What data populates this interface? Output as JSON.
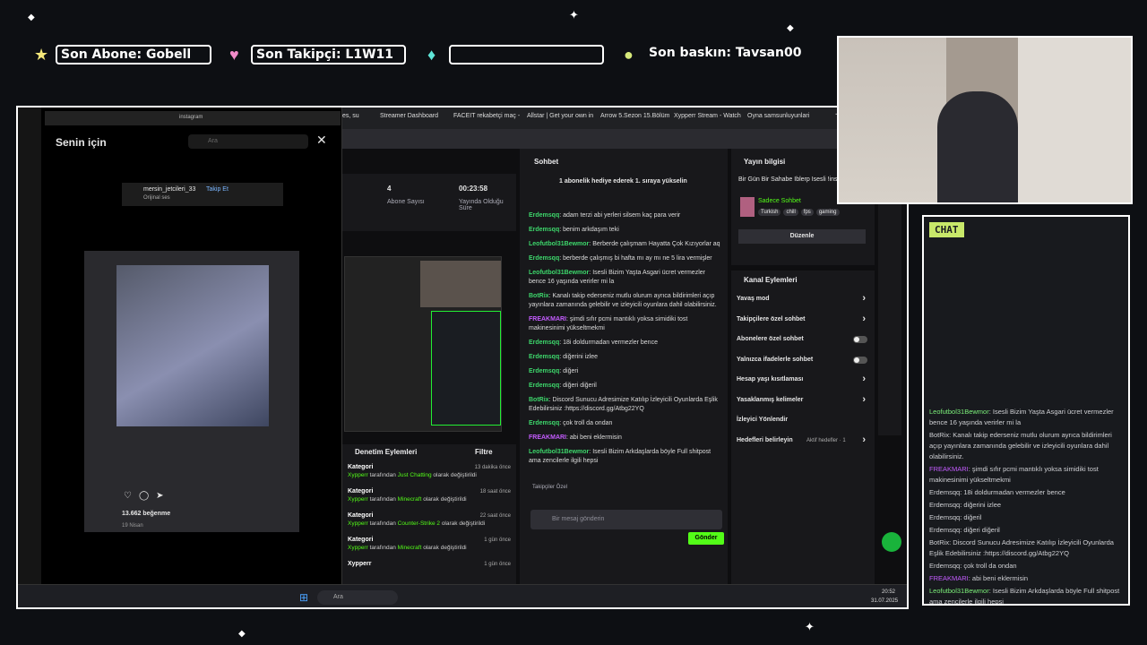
{
  "alerts": {
    "sub": "Son Abone: Gobell",
    "follow": "Son Takipçi: L1W11",
    "bits": "",
    "raid": "Son baskın: Tavsan00"
  },
  "browser_tabs": [
    "es, su",
    "Streamer Dashboard",
    "FACEIT rekabetçi maç -",
    "Allstar | Get your own in",
    "Arrow 5.Sezon 15.Bölüm",
    "Xypperr Stream - Watch",
    "Oyna samsunluyunlari"
  ],
  "instagram": {
    "url": "instagram",
    "header": "Senin için",
    "search": "Ara",
    "account": "mersin_jetcileri_33",
    "follow": "Takip Et",
    "audio": "Orijinal ses",
    "likes": "13.662 beğenme",
    "date": "19 Nisan"
  },
  "stats": {
    "subs": "4",
    "subs_label": "Abone Sayısı",
    "uptime": "00:23:58",
    "uptime_label": "Yayında Olduğu Süre"
  },
  "chat_panel": {
    "title": "Sohbet",
    "hype": "1 abonelik hediye ederek 1. sıraya yükselin",
    "placeholder": "Bir mesaj gönderin",
    "send": "Gönder",
    "follower_mode": "Takipçiler Özel",
    "messages": [
      {
        "user": "Erdemsqq",
        "text": "adam terzi abi yerleri silsem kaç para verir",
        "color": "#3dd66b"
      },
      {
        "user": "Erdemsqq",
        "text": "benim arkdaşım teki",
        "color": "#3dd66b"
      },
      {
        "user": "Leofutbol31Bewmor",
        "text": "Berberde çalışmam Hayatta Çok Kızıyorlar aq",
        "color": "#3dd66b"
      },
      {
        "user": "Erdemsqq",
        "text": "berberde çalışmış bi hafta mı ay mı ne 5 lira vermişler",
        "color": "#3dd66b"
      },
      {
        "user": "Leofutbol31Bewmor",
        "text": "Isesli Bizim Yaşta Asgari ücret vermezler bence 16 yaşında verirler mi la",
        "color": "#3dd66b"
      },
      {
        "user": "BotRix",
        "text": "Kanalı takip ederseniz mutlu olurum ayrıca bildirimleri açıp yayınlara zamanında gelebilir ve izleyicili oyunlara dahil olabilirsiniz.",
        "color": "#3dd66b"
      },
      {
        "user": "FREAKMARI",
        "text": "şimdi sıfır pcmi mantıklı yoksa simidiki tost makinesinimi yükseltmekmi",
        "color": "#c45cff"
      },
      {
        "user": "Erdemsqq",
        "text": "18i doldurmadan vermezler bence",
        "color": "#3dd66b"
      },
      {
        "user": "Erdemsqq",
        "text": "diğerini izlee",
        "color": "#3dd66b"
      },
      {
        "user": "Erdemsqq",
        "text": "diğeri",
        "color": "#3dd66b"
      },
      {
        "user": "Erdemsqq",
        "text": "diğeri diğeril",
        "color": "#3dd66b"
      },
      {
        "user": "BotRix",
        "text": "Discord Sunucu Adresimize Katılıp İzleyicili Oyunlarda Eşlik Edebilirsiniz :https://discord.gg/Atbg22YQ",
        "color": "#3dd66b"
      },
      {
        "user": "Erdemsqq",
        "text": "çok troll da ondan",
        "color": "#3dd66b"
      },
      {
        "user": "FREAKMARI",
        "text": "abi beni eklermisin",
        "color": "#c45cff"
      },
      {
        "user": "Leofutbol31Bewmor",
        "text": "Isesli Bizim Arkdaşlarda böyle Full shitpost ama zencilerle ilgili hepsi",
        "color": "#3dd66b"
      }
    ]
  },
  "stream_info": {
    "title": "Yayın bilgisi",
    "stream_title": "Bir Gün Bir Sahabe Iblerp Isesli !insta !dc",
    "category": "Sadece Sohbet",
    "tags": [
      "Turkish",
      "chill",
      "fps",
      "gaming"
    ],
    "edit": "Düzenle"
  },
  "channel_actions": {
    "title": "Kanal Eylemleri",
    "items": [
      "Yavaş mod",
      "Takipçilere özel sohbet",
      "Abonelere özel sohbet",
      "Yalnızca ifadelerle sohbet",
      "Hesap yaşı kısıtlaması",
      "Yasaklanmış kelimeler",
      "İzleyici Yönlendir",
      "Hedefleri belirleyin"
    ],
    "goal": "Aktif hedefler · 1"
  },
  "mod_actions": {
    "title": "Denetim Eylemleri",
    "filter": "Filtre",
    "items": [
      {
        "kind": "Kategori",
        "by": "Xypperr",
        "pre": "tarafından",
        "cat": "Just Chatting",
        "post": "olarak değiştirildi",
        "time": "13 dakika önce"
      },
      {
        "kind": "Kategori",
        "by": "Xypperr",
        "pre": "tarafından",
        "cat": "Minecraft",
        "post": "olarak değiştirildi",
        "time": "18 saat önce"
      },
      {
        "kind": "Kategori",
        "by": "Xypperr",
        "pre": "tarafından",
        "cat": "Counter-Strike 2",
        "post": "olarak değiştirildi",
        "time": "22 saat önce"
      },
      {
        "kind": "Kategori",
        "by": "Xypperr",
        "pre": "tarafından",
        "cat": "Minecraft",
        "post": "olarak değiştirildi",
        "time": "1 gün önce"
      },
      {
        "kind": "Xypperr",
        "by": "",
        "pre": "",
        "cat": "",
        "post": "",
        "time": "1 gün önce"
      }
    ]
  },
  "taskbar": {
    "search": "Ara",
    "time": "20:52",
    "date": "31.07.2025"
  },
  "overlay_chat": {
    "title": "CHAT",
    "lines": [
      {
        "user": "Leofutbol31Bewmor",
        "text": ": Isesli Bizim Yaşta Asgari ücret vermezler bence 16 yaşında verirler mi la"
      },
      {
        "user": "BotRix",
        "text": ": Kanalı takip ederseniz mutlu olurum ayrıca bildirimleri açıp yayınlara zamanında gelebilir ve izleyicili oyunlara dahil olabilirsiniz."
      },
      {
        "user": "FREAKMARI",
        "text": ": şimdi sıfır pcmi mantıklı yoksa simidiki tost makinesinimi yükseltmekmi"
      },
      {
        "user": "Erdemsqq",
        "text": ": 18i doldurmadan vermezler bence"
      },
      {
        "user": "Erdemsqq",
        "text": ": diğerini izlee"
      },
      {
        "user": "Erdemsqq",
        "text": ": diğeril"
      },
      {
        "user": "Erdemsqq",
        "text": ": diğeri diğeril"
      },
      {
        "user": "BotRix",
        "text": ": Discord Sunucu Adresimize Katılıp İzleyicili Oyunlarda Eşlik Edebilirsiniz :https://discord.gg/Atbg22YQ"
      },
      {
        "user": "Erdemsqq",
        "text": ": çok troll da ondan"
      },
      {
        "user": "FREAKMARI",
        "text": ": abi beni eklermisin"
      },
      {
        "user": "Leofutbol31Bewmor",
        "text": ": Isesli Bizim Arkdaşlarda böyle Full shitpost ama zencilerle ilgili hepsi"
      }
    ]
  }
}
